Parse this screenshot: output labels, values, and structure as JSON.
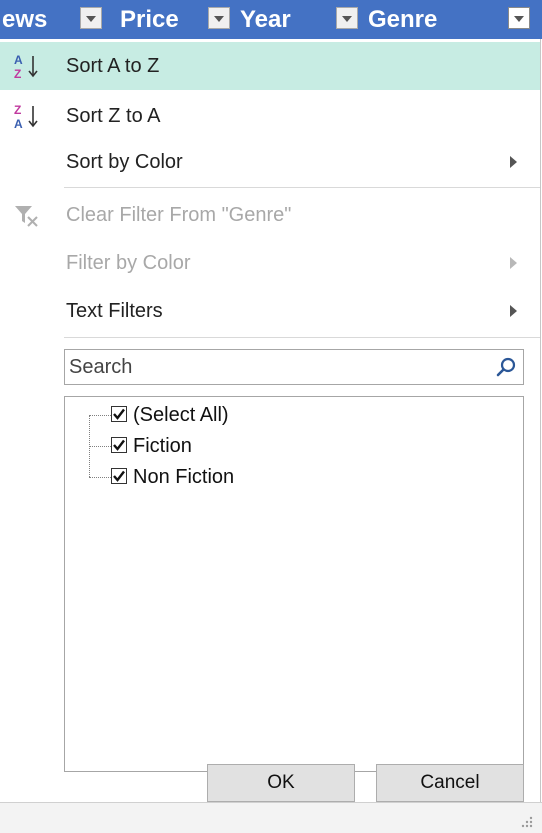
{
  "header": {
    "columns": [
      {
        "label": "ews"
      },
      {
        "label": "Price"
      },
      {
        "label": "Year"
      },
      {
        "label": "Genre"
      }
    ]
  },
  "menu": {
    "sort_az": "Sort A to Z",
    "sort_za": "Sort Z to A",
    "sort_by_color": "Sort by Color",
    "clear_filter": "Clear Filter From \"Genre\"",
    "filter_by_color": "Filter by Color",
    "text_filters": "Text Filters"
  },
  "search": {
    "placeholder": "Search",
    "value": ""
  },
  "list": {
    "items": [
      {
        "label": "(Select All)",
        "checked": true
      },
      {
        "label": "Fiction",
        "checked": true
      },
      {
        "label": "Non Fiction",
        "checked": true
      }
    ]
  },
  "buttons": {
    "ok": "OK",
    "cancel": "Cancel"
  },
  "colors": {
    "header_bg": "#4472c4",
    "hover_bg": "#c7ece3",
    "disabled_text": "#a8a8a8"
  }
}
